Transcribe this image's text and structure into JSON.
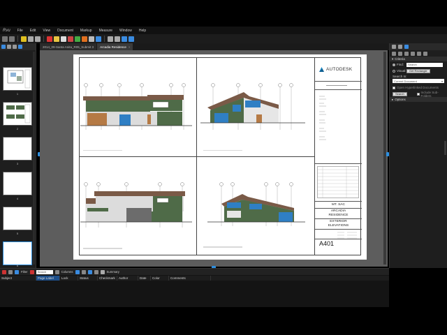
{
  "app": {
    "logo_text": "Rvu"
  },
  "menu": {
    "items": [
      "File",
      "Edit",
      "View",
      "Document",
      "Markup",
      "Measure",
      "Window",
      "Help"
    ]
  },
  "tabs": [
    {
      "label": "2014_09-Santa Anita_R05_Submit 3",
      "active": false
    },
    {
      "label": "Arcadia Residence",
      "active": true
    }
  ],
  "thumbnails": [
    {
      "page": "1"
    },
    {
      "page": "2"
    },
    {
      "page": "3"
    },
    {
      "page": "4"
    },
    {
      "page": "5"
    },
    {
      "page": "6"
    }
  ],
  "sheet": {
    "company": "AUTODESK",
    "school": "MT. SAC",
    "project_line1": "ARCADIA",
    "project_line2": "RESIDENCE",
    "title_line1": "EXTERIOR",
    "title_line2": "ELEVATIONS",
    "sheet_number": "A401"
  },
  "search_panel": {
    "section_criteria": "Criteria",
    "find_label": "Find:",
    "find_placeholder": "Search",
    "visual_label": "Visual:",
    "get_rectangle": "Get Rectangle",
    "search_in_label": "Search In:",
    "search_in_value": "Current Document",
    "option_hyperlinked": "Open Hyperlinked Documents",
    "search_button": "Search",
    "include_subfolders": "Include Sub-Folders",
    "section_options": "Options"
  },
  "markups": {
    "filter_label": "Filter",
    "search_placeholder": "Search",
    "columns_label": "Columns",
    "summary_label": "Summary",
    "headers": [
      "Subject",
      "Page Label",
      "Lock",
      "Status",
      "Checkmark",
      "Author",
      "Date",
      "Color",
      "Comments"
    ],
    "selected_header": "Page Label"
  },
  "colors": {
    "accent": "#2d8fe0",
    "panel_bg": "#1e1e1e",
    "canvas_bg": "#5d5d5d",
    "siding_green": "#4f6b48",
    "roof_brown": "#7a5a47",
    "window_blue": "#2f7fc4",
    "garage_orange": "#b57a45"
  }
}
